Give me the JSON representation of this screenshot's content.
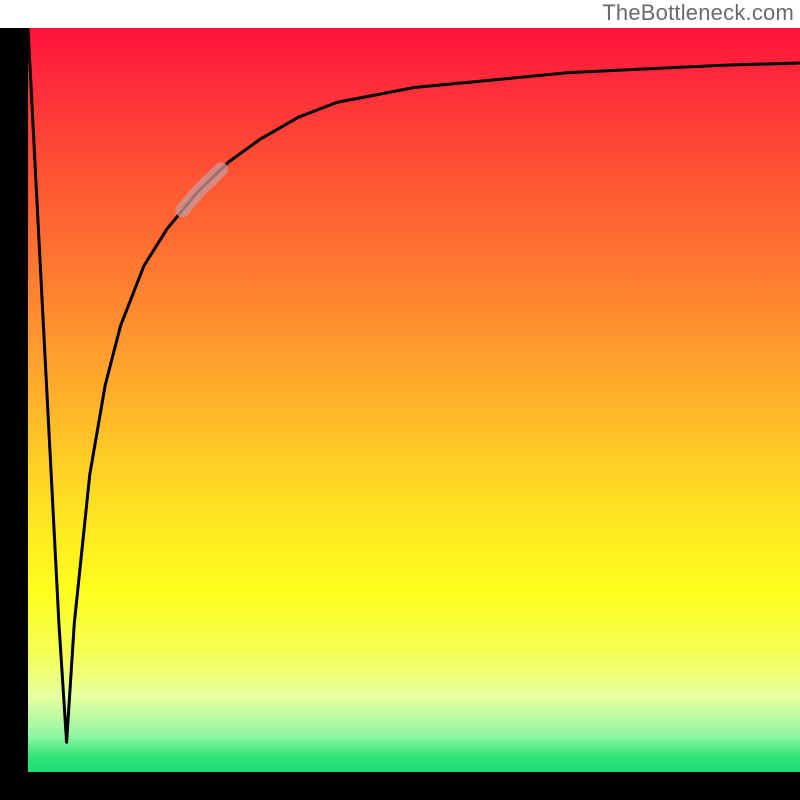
{
  "attribution": "TheBottleneck.com",
  "colors": {
    "frame": "#000000",
    "curve": "#000000",
    "highlight": "#c99a9a",
    "gradient_top": "#ff123c",
    "gradient_bottom": "#1edc73"
  },
  "chart_data": {
    "type": "line",
    "title": "",
    "xlabel": "",
    "ylabel": "",
    "xlim": [
      0,
      100
    ],
    "ylim": [
      0,
      100
    ],
    "series": [
      {
        "name": "bottleneck-curve",
        "x": [
          0,
          1,
          2,
          3,
          4,
          5,
          6,
          8,
          10,
          12,
          15,
          18,
          22,
          26,
          30,
          35,
          40,
          50,
          60,
          70,
          80,
          90,
          100
        ],
        "values": [
          100,
          80,
          60,
          40,
          20,
          4,
          20,
          40,
          52,
          60,
          68,
          73,
          78,
          82,
          85,
          88,
          90,
          92,
          93,
          94,
          94.5,
          95,
          95.3
        ]
      }
    ],
    "highlight_range_x": [
      20,
      25
    ],
    "annotations": []
  }
}
